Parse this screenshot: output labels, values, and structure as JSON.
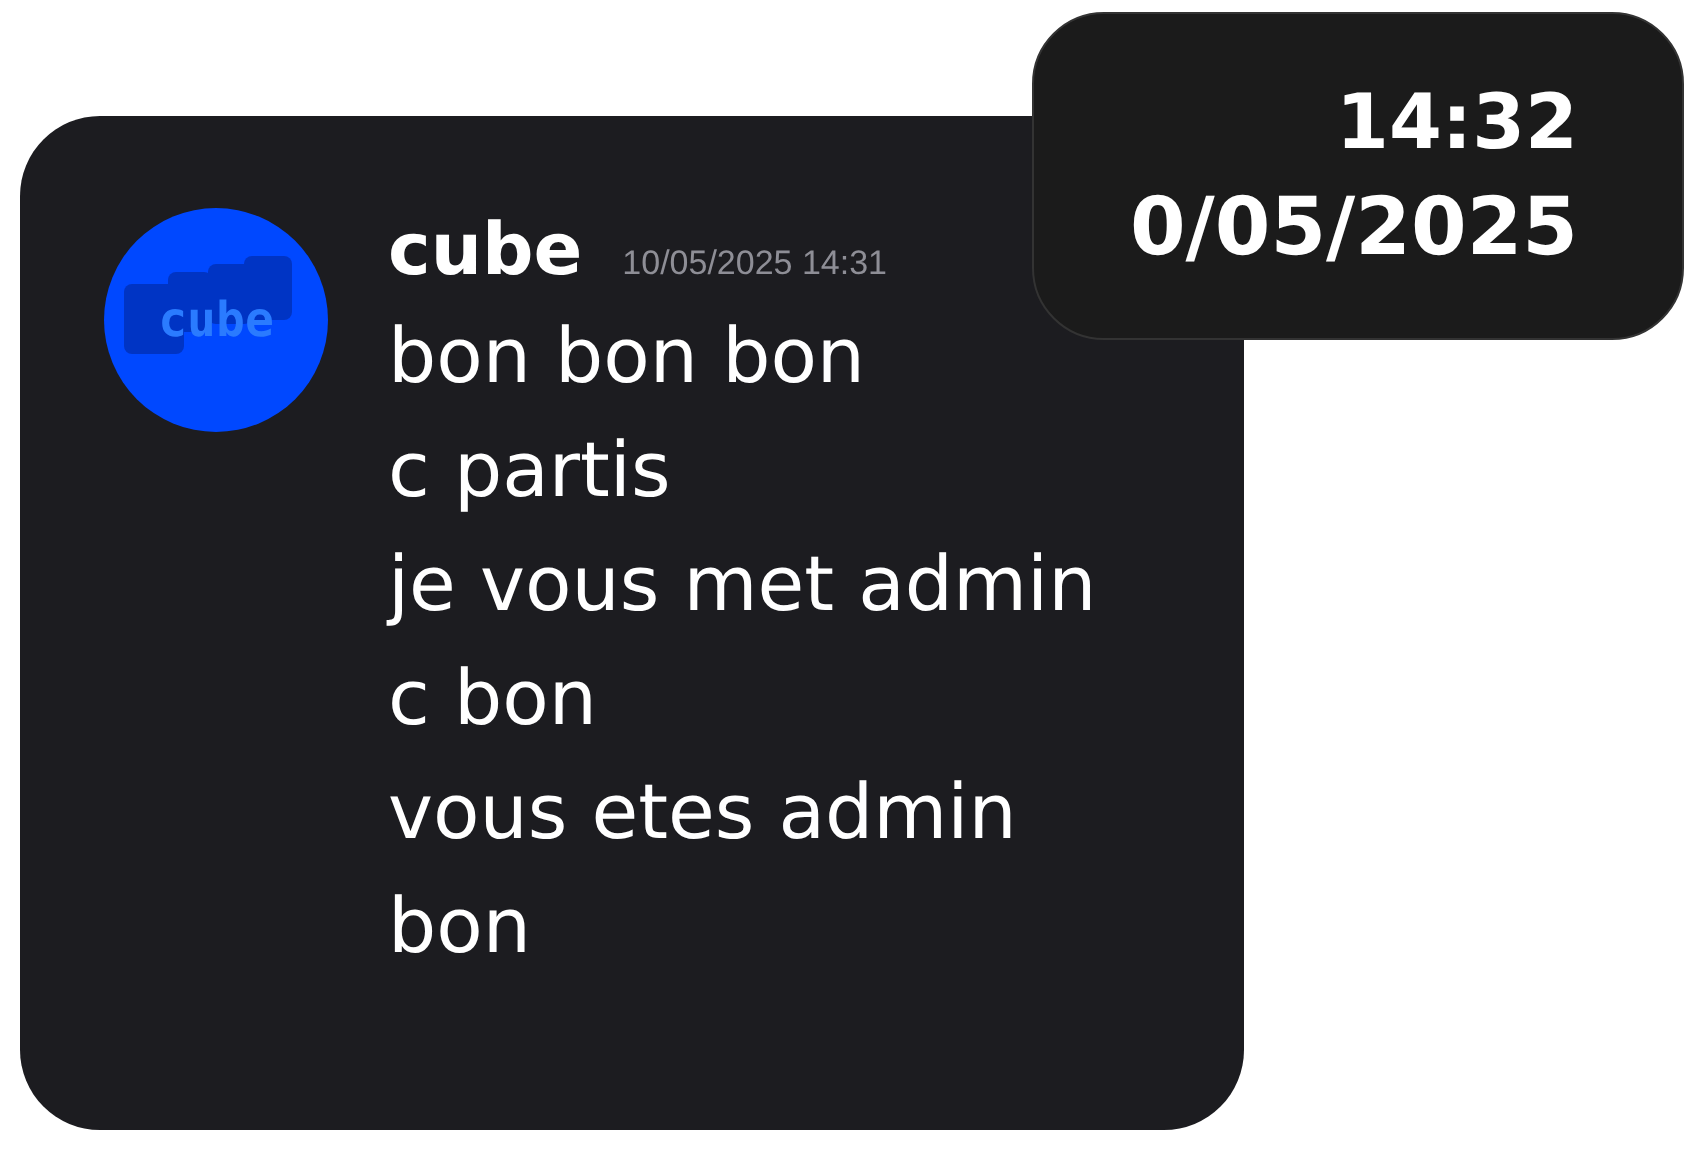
{
  "message": {
    "avatar_text": "cube",
    "username": "cube",
    "timestamp": "10/05/2025 14:31",
    "lines": [
      "bon bon bon",
      "c partis",
      "je vous met admin",
      "c bon",
      "vous etes admin",
      "bon"
    ]
  },
  "clock": {
    "time": "14:32",
    "date": "0/05/2025"
  }
}
